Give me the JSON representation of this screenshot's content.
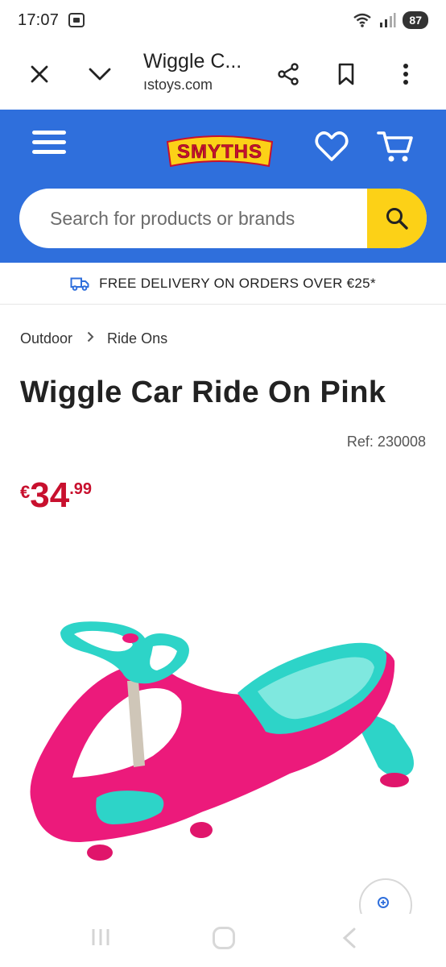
{
  "status_bar": {
    "time": "17:07",
    "battery": "87"
  },
  "browser": {
    "tab_title": "Wiggle C...",
    "url": "ıstoys.com"
  },
  "header": {
    "logo_text": "SMYTHS",
    "search_placeholder": "Search for products or brands",
    "brand_blue": "#2f6fdc",
    "accent_yellow": "#fcd117"
  },
  "promo": {
    "delivery_text": "FREE DELIVERY ON ORDERS OVER €25*"
  },
  "breadcrumb": {
    "items": [
      "Outdoor",
      "Ride Ons"
    ]
  },
  "product": {
    "title": "Wiggle Car Ride On Pink",
    "ref": "Ref: 230008",
    "price_currency": "€",
    "price_whole": "34",
    "price_cents": ".99",
    "price_color": "#c8102e"
  }
}
